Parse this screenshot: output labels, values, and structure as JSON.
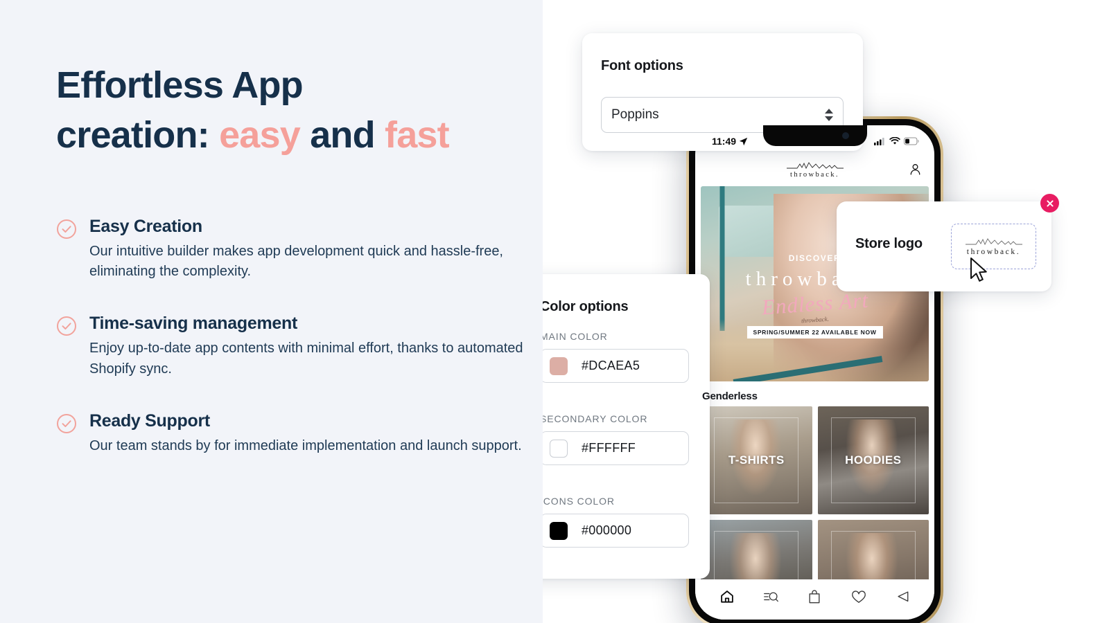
{
  "left": {
    "headline": {
      "line1": "Effortless App",
      "line2_pre": "creation: ",
      "line2_accent1": "easy",
      "line2_mid": " and ",
      "line2_accent2": "fast"
    },
    "features": [
      {
        "icon": "check-circle-icon",
        "title": "Easy Creation",
        "desc": "Our intuitive builder makes app development quick and hassle-free, eliminating the complexity."
      },
      {
        "icon": "check-circle-icon",
        "title": "Time-saving management",
        "desc": "Enjoy up-to-date app contents with minimal effort, thanks to automated Shopify sync."
      },
      {
        "icon": "check-circle-icon",
        "title": "Ready Support",
        "desc": "Our team stands by for immediate implementation and launch support."
      }
    ]
  },
  "font_card": {
    "title": "Font options",
    "selected_font": "Poppins",
    "stepper_icon": "up-down-stepper-icon"
  },
  "color_card": {
    "title": "Color options",
    "groups": [
      {
        "label": "MAIN COLOR",
        "value": "#DCAEA5",
        "swatch": "#DCAEA5"
      },
      {
        "label": "SECONDARY COLOR",
        "value": "#FFFFFF",
        "swatch": "#FFFFFF"
      },
      {
        "label": "ICONS COLOR",
        "value": "#000000",
        "swatch": "#000000"
      }
    ]
  },
  "logo_card": {
    "title": "Store logo",
    "logo_text": "throwback.",
    "close_icon": "close-x-icon",
    "close_color": "#E81D62",
    "cursor_icon": "mouse-pointer-icon"
  },
  "phone": {
    "status": {
      "time": "11:49",
      "location_icon": "location-arrow-icon",
      "signal_icon": "cellular-signal-icon",
      "wifi_icon": "wifi-icon",
      "battery_icon": "battery-icon"
    },
    "header": {
      "brand": "throwback.",
      "account_icon": "account-person-icon"
    },
    "hero": {
      "kicker": "DISCOVER",
      "brand": "throwback.",
      "script": "Endless Art",
      "badge": "SPRING/SUMMER 22 AVAILABLE NOW",
      "subtag": "throwback."
    },
    "section_title": "Genderless",
    "tiles": [
      {
        "label": "T-SHIRTS"
      },
      {
        "label": "HOODIES"
      },
      {
        "label": ""
      },
      {
        "label": ""
      }
    ],
    "tabbar": [
      {
        "icon": "home-icon",
        "active": true
      },
      {
        "icon": "search-filter-icon",
        "active": false
      },
      {
        "icon": "shopping-bag-icon",
        "active": false
      },
      {
        "icon": "heart-icon",
        "active": false
      },
      {
        "icon": "megaphone-icon",
        "active": false
      }
    ]
  }
}
